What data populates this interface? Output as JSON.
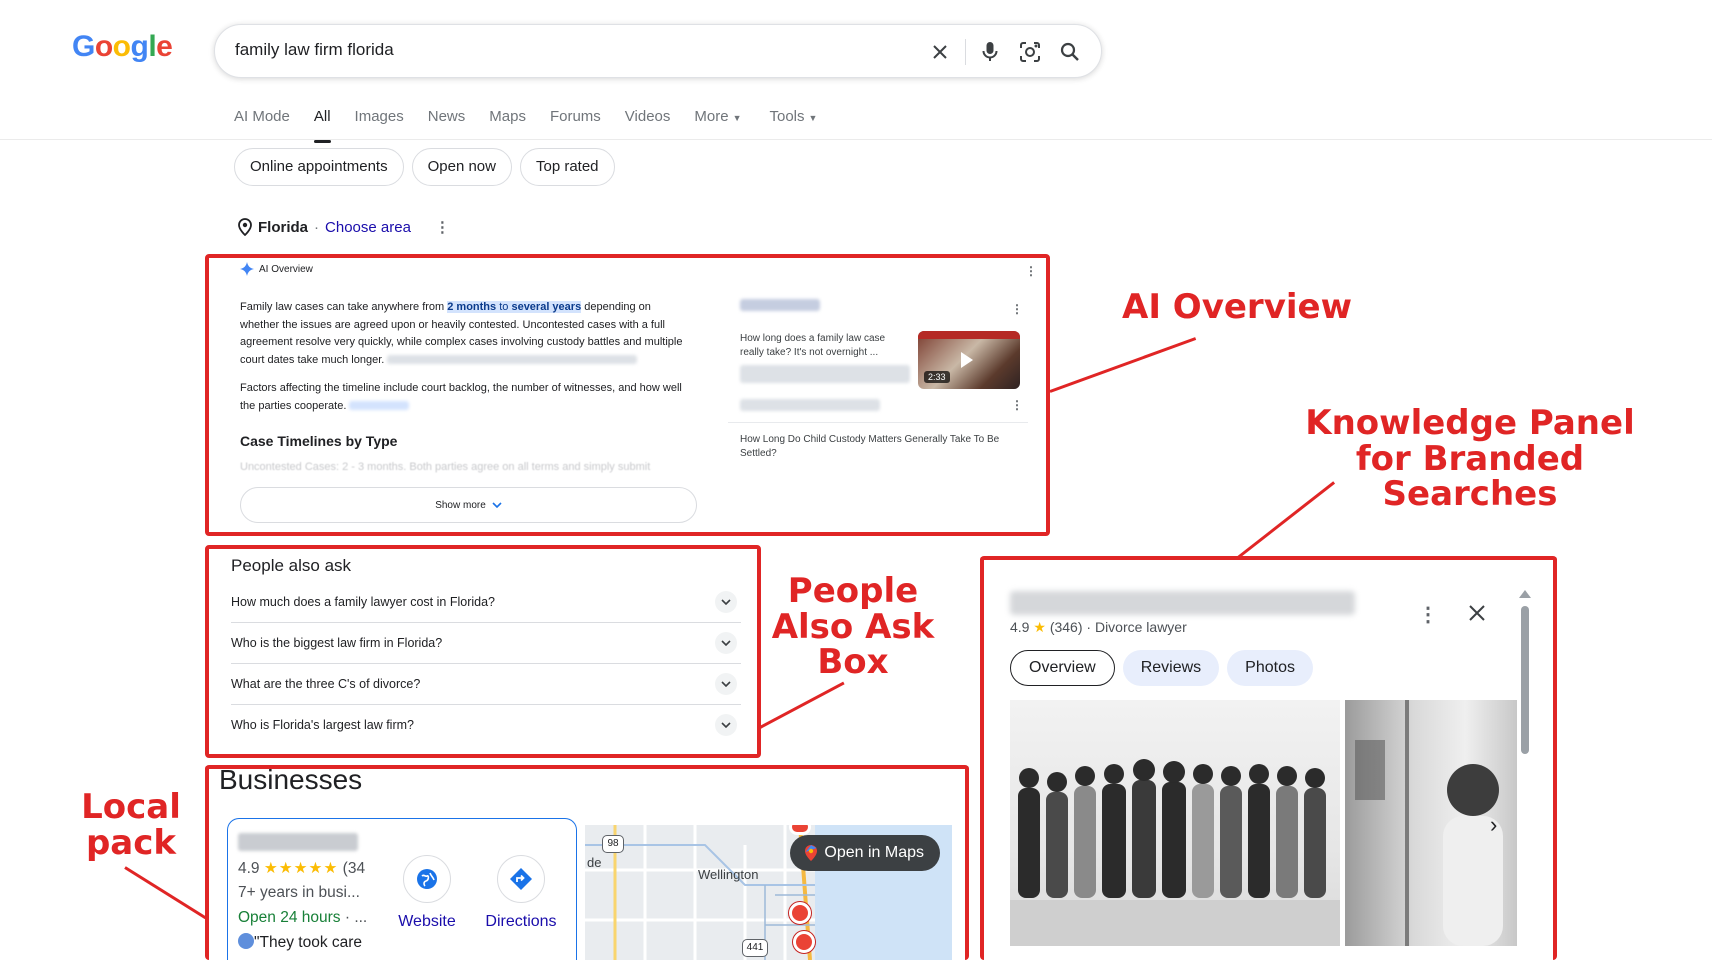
{
  "header": {
    "logo": [
      "G",
      "o",
      "o",
      "g",
      "l",
      "e"
    ],
    "search_value": "family law firm florida",
    "icons": [
      "close-icon",
      "mic-icon",
      "lens-icon",
      "search-icon"
    ]
  },
  "tabs": [
    {
      "label": "AI Mode"
    },
    {
      "label": "All",
      "active": true
    },
    {
      "label": "Images"
    },
    {
      "label": "News"
    },
    {
      "label": "Maps"
    },
    {
      "label": "Forums"
    },
    {
      "label": "Videos"
    },
    {
      "label": "More",
      "caret": true
    },
    {
      "label": "Tools",
      "caret": true
    }
  ],
  "chips": [
    "Online appointments",
    "Open now",
    "Top rated"
  ],
  "location": {
    "name": "Florida",
    "separator": "·",
    "choose": "Choose area"
  },
  "ai_overview": {
    "header": "AI Overview",
    "p1_start": "Family law cases can take anywhere from ",
    "p1_hl1": "2 months",
    "p1_mid": " to ",
    "p1_hl2": "several years",
    "p1_end": " depending on whether the issues are agreed upon or heavily contested. Uncontested cases with a full agreement resolve very quickly, while complex cases involving custody battles and multiple court dates take much longer.",
    "p2": "Factors affecting the timeline include court backlog, the number of witnesses, and how well the parties cooperate.",
    "subheading": "Case Timelines by Type",
    "faded": "Uncontested Cases: 2 - 3 months. Both parties agree on all terms and simply submit",
    "show_more": "Show more",
    "card1_title": "How long does a family law case really take? It's not overnight ...",
    "video_duration": "2:33",
    "card2_title": "How Long Do Child Custody Matters Generally Take To Be Settled?"
  },
  "people_also_ask": {
    "title": "People also ask",
    "questions": [
      "How much does a family lawyer cost in Florida?",
      "Who is the biggest law firm in Florida?",
      "What are the three C's of divorce?",
      "Who is Florida's largest law firm?"
    ]
  },
  "businesses": {
    "title": "Businesses",
    "rating": "4.9",
    "stars": "★★★★★",
    "reviews_partial": "(34",
    "years": "7+ years in busi...",
    "hours": "Open 24 hours",
    "hours_suffix": " · ...",
    "quote": "\"They took care",
    "website_label": "Website",
    "directions_label": "Directions",
    "open_in_maps": "Open in Maps",
    "map_labels": {
      "city": "Wellington",
      "road1": "98",
      "road2": "441",
      "fragment": "de"
    }
  },
  "knowledge_panel": {
    "rating": "4.9",
    "star": "★",
    "reviews": "(346)",
    "separator": "·",
    "category": "Divorce lawyer",
    "tabs": [
      "Overview",
      "Reviews",
      "Photos"
    ]
  },
  "annotations": {
    "ai_overview": "AI Overview",
    "knowledge_panel": [
      "Knowledge Panel",
      "for Branded",
      "Searches"
    ],
    "people_also_ask": [
      "People",
      "Also Ask",
      "Box"
    ],
    "local_pack": [
      "Local",
      "pack"
    ]
  },
  "colors": {
    "annotation_red": "#e02525",
    "link_blue": "#1a0dab",
    "star_yellow": "#fbbc04",
    "open_green": "#188038"
  }
}
